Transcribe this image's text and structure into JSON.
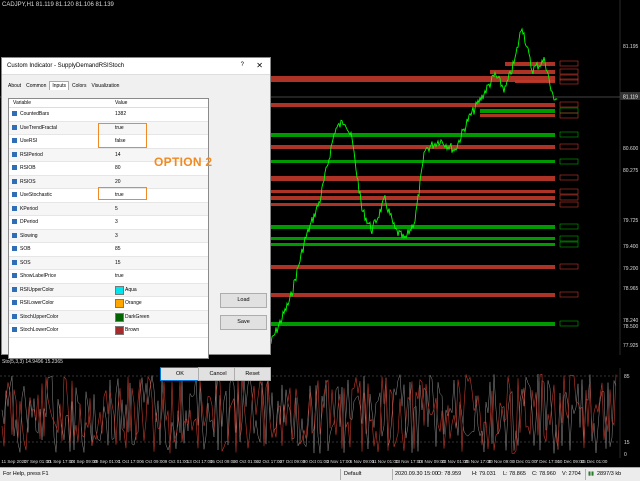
{
  "window": {
    "symbol_info": "CADJPY,H1  81.119 81.120 81.106 81.139",
    "osc_info": "Sto(5,3,3) 14.9496 15.2365"
  },
  "dialog": {
    "title": "Custom Indicator - SupplyDemandRSIStoch",
    "help": "?",
    "close": "✕",
    "tabs": [
      "About",
      "Common",
      "Inputs",
      "Colors",
      "Visualization"
    ],
    "active_tab": "Inputs",
    "headers": {
      "variable": "Variable",
      "value": "Value"
    },
    "params": [
      {
        "name": "CountedBars",
        "value": "1382",
        "type": "int"
      },
      {
        "name": "UseTrendFractal",
        "value": "true",
        "type": "bool"
      },
      {
        "name": "UseRSI",
        "value": "false",
        "type": "bool"
      },
      {
        "name": "RSIPeriod",
        "value": "14",
        "type": "int"
      },
      {
        "name": "RSIOB",
        "value": "80",
        "type": "int"
      },
      {
        "name": "RSIOS",
        "value": "20",
        "type": "int"
      },
      {
        "name": "UseStochastic",
        "value": "true",
        "type": "bool"
      },
      {
        "name": "KPeriod",
        "value": "5",
        "type": "int"
      },
      {
        "name": "DPeriod",
        "value": "3",
        "type": "int"
      },
      {
        "name": "Slowing",
        "value": "3",
        "type": "int"
      },
      {
        "name": "SOB",
        "value": "85",
        "type": "int"
      },
      {
        "name": "SOS",
        "value": "15",
        "type": "int"
      },
      {
        "name": "ShowLabelPrice",
        "value": "true",
        "type": "bool"
      },
      {
        "name": "RSIUpperColor",
        "value": "Aqua",
        "type": "color",
        "color": "#00e5ee"
      },
      {
        "name": "RSILowerColor",
        "value": "Orange",
        "type": "color",
        "color": "#ffa500"
      },
      {
        "name": "StochUpperColor",
        "value": "DarkGreen",
        "type": "color",
        "color": "#006400"
      },
      {
        "name": "StochLowerColor",
        "value": "Brown",
        "type": "color",
        "color": "#a52a2a"
      }
    ],
    "option_label": "OPTION 2",
    "buttons": {
      "load": "Load",
      "save": "Save",
      "ok": "OK",
      "cancel": "Cancel",
      "reset": "Reset"
    }
  },
  "price_axis": {
    "labels": [
      "81.195",
      "80.600",
      "80.275",
      "79.725",
      "79.400",
      "79.200",
      "78.965",
      "78.500",
      "78.240",
      "77.925"
    ],
    "current": "81.119"
  },
  "osc_axis": {
    "labels": [
      "85",
      "15",
      "0"
    ]
  },
  "time_axis": {
    "labels": [
      "11 Sep 2020",
      "17 Sep 01:00",
      "21 Sep 17:00",
      "24 Sep 09:00",
      "29 Sep 01:00",
      "1 Oct 17:00",
      "6 Oct 09:00",
      "9 Oct 01:00",
      "13 Oct 17:00",
      "15 Oct 09:00",
      "20 Oct 01:00",
      "22 Oct 17:00",
      "27 Oct 09:00",
      "30 Oct 01:00",
      "3 Nov 17:00",
      "6 Nov 09:00",
      "11 Nov 01:00",
      "13 Nov 17:00",
      "18 Nov 09:00",
      "23 Nov 01:00",
      "25 Nov 17:00",
      "30 Nov 09:00",
      "3 Dec 01:00",
      "7 Dec 17:00",
      "10 Dec 09:00",
      "15 Dec 01:00"
    ]
  },
  "status": {
    "help": "For Help, press F1",
    "profile": "Default",
    "time": "2020.09.30 15:00",
    "open": "O: 78.959",
    "high": "H: 79.031",
    "low": "L: 78.865",
    "close": "C: 78.960",
    "volume": "V: 2704",
    "traffic": "2897/3 kb"
  },
  "colors": {
    "background": "#000000",
    "candles": "#00ff00",
    "supply_zone": "#c0392b",
    "demand_zone": "#00aa00",
    "stoch_main": "#c0392b",
    "stoch_signal": "#909090",
    "highlight": "#f08a24"
  }
}
